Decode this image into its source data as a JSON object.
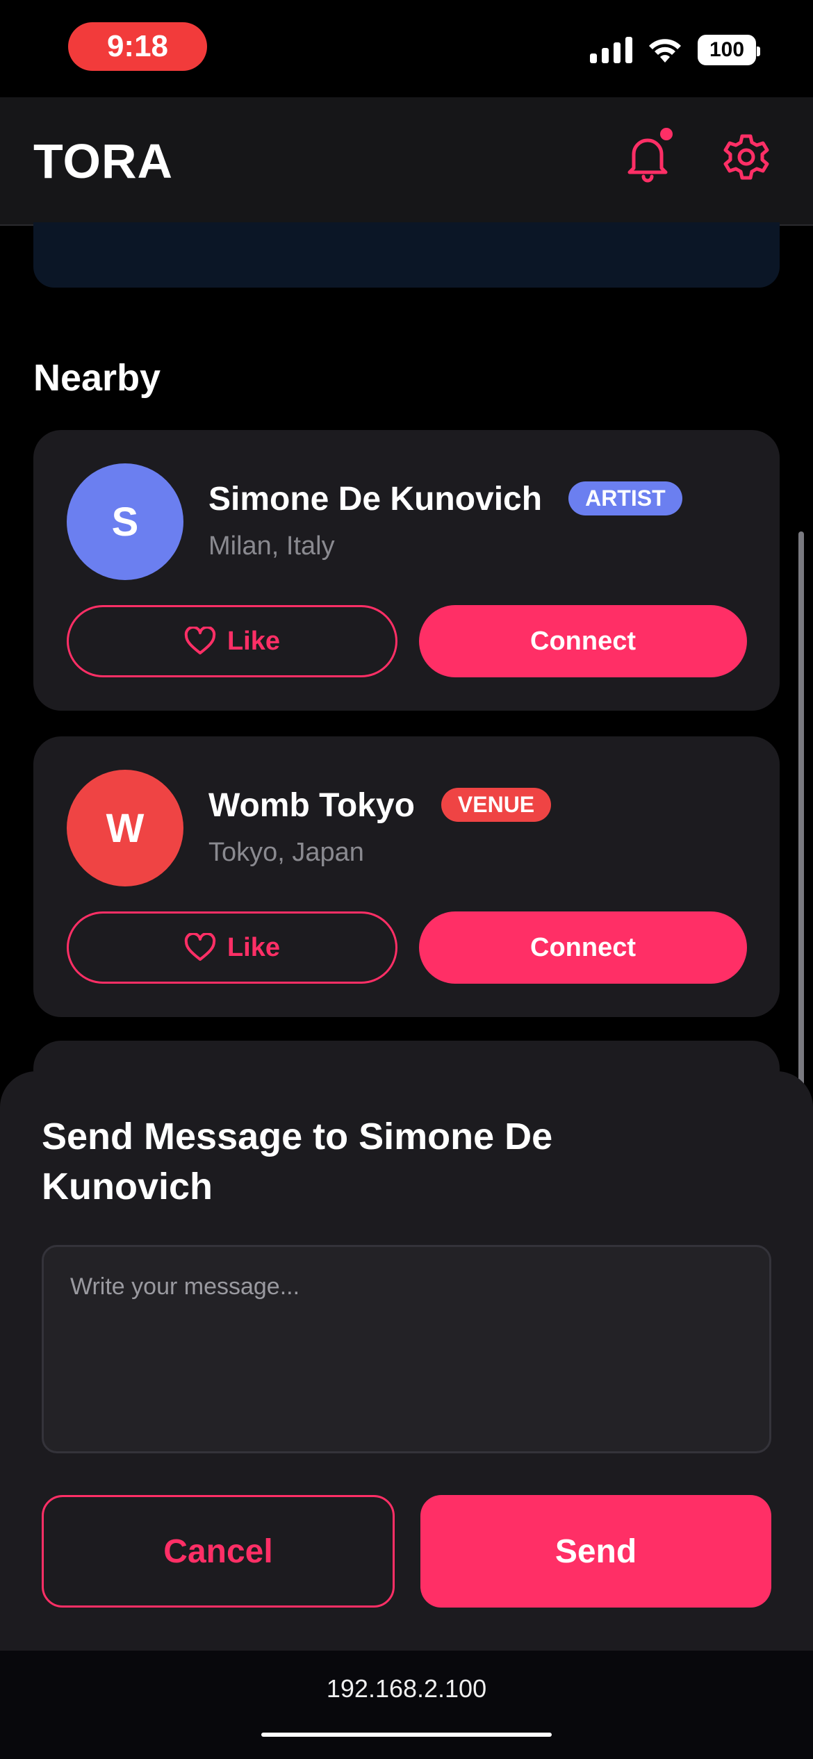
{
  "status_bar": {
    "time": "9:18",
    "battery": "100"
  },
  "header": {
    "title": "TORA",
    "has_notification": true
  },
  "nearby": {
    "title": "Nearby",
    "cards": [
      {
        "initial": "S",
        "name": "Simone De Kunovich",
        "badge": "ARTIST",
        "location": "Milan, Italy",
        "like_label": "Like",
        "connect_label": "Connect"
      },
      {
        "initial": "W",
        "name": "Womb Tokyo",
        "badge": "VENUE",
        "location": "Tokyo, Japan",
        "like_label": "Like",
        "connect_label": "Connect"
      }
    ]
  },
  "message_sheet": {
    "title": "Send Message to Simone De Kunovich",
    "placeholder": "Write your message...",
    "cancel_label": "Cancel",
    "send_label": "Send"
  },
  "browser": {
    "url": "192.168.2.100"
  },
  "colors": {
    "accent": "#ff2f66",
    "artist_badge": "#6b7ff0",
    "venue_badge": "#ef4444",
    "avatar_s": "#6b7ff0",
    "avatar_w": "#ef4444",
    "card_bg": "#1c1b1f"
  }
}
